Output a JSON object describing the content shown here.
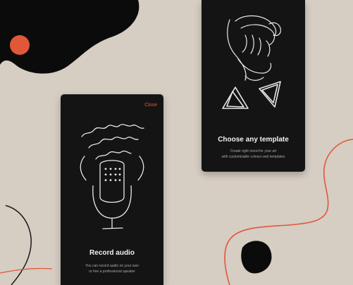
{
  "colors": {
    "background": "#d6cdc3",
    "phone": "#141414",
    "accent": "#e0573a",
    "blob": "#0b0b0b",
    "sketch": "#e8e8e8"
  },
  "record_screen": {
    "close_label": "Close",
    "title": "Record audio",
    "description_line1": "You can record audio on your own",
    "description_line2": "or hire a professional speaker",
    "illustration_icon": "microphone-sketch-icon"
  },
  "template_screen": {
    "title": "Choose any template",
    "description_line1": "Create right mood for your art",
    "description_line2": "with customizable colours and templates",
    "illustration_icon": "face-and-triangles-sketch-icon"
  }
}
